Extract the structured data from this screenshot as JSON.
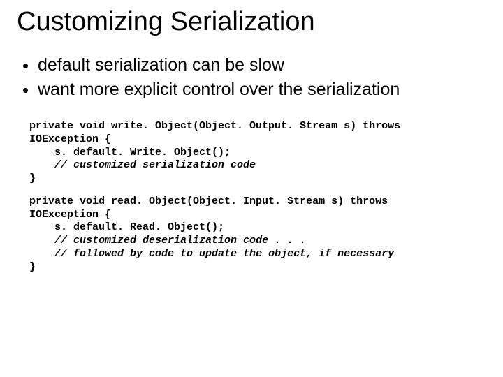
{
  "slide": {
    "title": "Customizing Serialization",
    "bullets": [
      "default serialization can be slow",
      "want more explicit control over the serialization"
    ],
    "code1": {
      "sig_a": "private void write. Object(Object. Output. Stream s) throws",
      "sig_b": "IOException {",
      "line1": "    s. default. Write. Object();",
      "line2_prefix": "    ",
      "line2": "// customized serialization code",
      "close": "}"
    },
    "code2": {
      "sig_a": "private void read. Object(Object. Input. Stream s) throws",
      "sig_b": "IOException {",
      "line1": "    s. default. Read. Object();",
      "line2_prefix": "    ",
      "line2": "// customized deserialization code . . .",
      "line3_prefix": "    ",
      "line3": "// followed by code to update the object, if necessary",
      "close": "}"
    }
  }
}
